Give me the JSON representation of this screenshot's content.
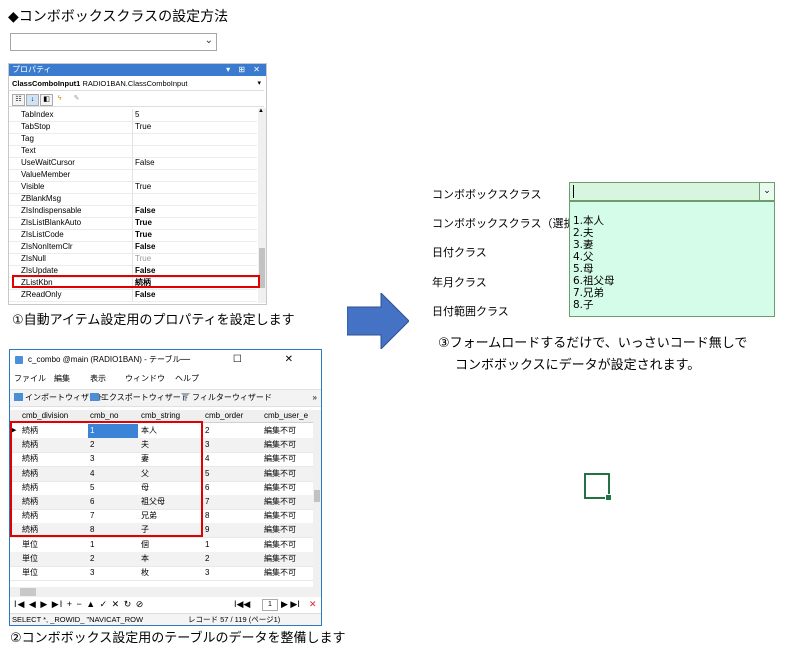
{
  "heading": "◆コンボボックスクラスの設定方法",
  "top_combo": {
    "value": "",
    "arrow": "chevron-down-icon"
  },
  "props": {
    "title": "プロパティ",
    "title_controls": "▾ ⊞ ✕",
    "object_name": "ClassComboInput1",
    "object_type": "RADIO1BAN.ClassComboInput",
    "rows": [
      {
        "name": "TabIndex",
        "value": "5",
        "style": ""
      },
      {
        "name": "TabStop",
        "value": "True",
        "style": ""
      },
      {
        "name": "Tag",
        "value": "",
        "style": ""
      },
      {
        "name": "Text",
        "value": "",
        "style": ""
      },
      {
        "name": "UseWaitCursor",
        "value": "False",
        "style": ""
      },
      {
        "name": "ValueMember",
        "value": "",
        "style": ""
      },
      {
        "name": "Visible",
        "value": "True",
        "style": ""
      },
      {
        "name": "ZBlankMsg",
        "value": "",
        "style": ""
      },
      {
        "name": "ZIsIndispensable",
        "value": "False",
        "style": "bold"
      },
      {
        "name": "ZIsListBlankAuto",
        "value": "True",
        "style": "bold"
      },
      {
        "name": "ZIsListCode",
        "value": "True",
        "style": "bold"
      },
      {
        "name": "ZIsNonItemClr",
        "value": "False",
        "style": "bold"
      },
      {
        "name": "ZIsNull",
        "value": "True",
        "style": "grey"
      },
      {
        "name": "ZIsUpdate",
        "value": "False",
        "style": "bold"
      },
      {
        "name": "ZListKbn",
        "value": "続柄",
        "style": "bold"
      },
      {
        "name": "ZReadOnly",
        "value": "False",
        "style": "bold"
      }
    ]
  },
  "caption1": "①自動アイテム設定用のプロパティを設定します",
  "caption2": "②コンボボックス設定用のテーブルのデータを整備します",
  "caption3_line1": "③フォームロードするだけで、いっさいコード無しで",
  "caption3_line2": "コンボボックスにデータが設定されます。",
  "form": {
    "labels": [
      "コンボボックスクラス",
      "コンボボックスクラス（選択のみ）",
      "日付クラス",
      "年月クラス",
      "日付範囲クラス"
    ],
    "combo_value": "",
    "list_items": [
      "1.本人",
      "2.夫",
      "3.妻",
      "4.父",
      "5.母",
      "6.祖父母",
      "7.兄弟",
      "8.子"
    ]
  },
  "nav": {
    "title": "c_combo @main (RADIO1BAN) - テーブル",
    "window_controls": "— ☐ ✕",
    "menu": [
      "ファイル",
      "編集",
      "表示",
      "ウィンドウ",
      "ヘルプ"
    ],
    "toolbar": [
      "インポートウィザード",
      "エクスポートウィザード",
      "フィルターウィザード"
    ],
    "toolbar_more": "»",
    "columns": [
      "cmb_division",
      "cmb_no",
      "cmb_string",
      "cmb_order",
      "cmb_user_e"
    ],
    "rows": [
      [
        "続柄",
        "1",
        "本人",
        "2",
        "編集不可"
      ],
      [
        "続柄",
        "2",
        "夫",
        "3",
        "編集不可"
      ],
      [
        "続柄",
        "3",
        "妻",
        "4",
        "編集不可"
      ],
      [
        "続柄",
        "4",
        "父",
        "5",
        "編集不可"
      ],
      [
        "続柄",
        "5",
        "母",
        "6",
        "編集不可"
      ],
      [
        "続柄",
        "6",
        "祖父母",
        "7",
        "編集不可"
      ],
      [
        "続柄",
        "7",
        "兄弟",
        "8",
        "編集不可"
      ],
      [
        "続柄",
        "8",
        "子",
        "9",
        "編集不可"
      ],
      [
        "単位",
        "1",
        "個",
        "1",
        "編集不可"
      ],
      [
        "単位",
        "2",
        "本",
        "2",
        "編集不可"
      ],
      [
        "単位",
        "3",
        "枚",
        "3",
        "編集不可"
      ]
    ],
    "nav_buttons_left": "I◀ ◀ ▶ ▶I + − ▲ ✓ ✕ ↻ ⊘",
    "page_controls": "I◀◀",
    "page_value": "1",
    "page_controls_right": "▶ ▶I",
    "status_sql": "SELECT *, _ROWID_ \"NAVICAT_ROW",
    "status_record": "レコード 57 / 119 (ページ1)"
  }
}
